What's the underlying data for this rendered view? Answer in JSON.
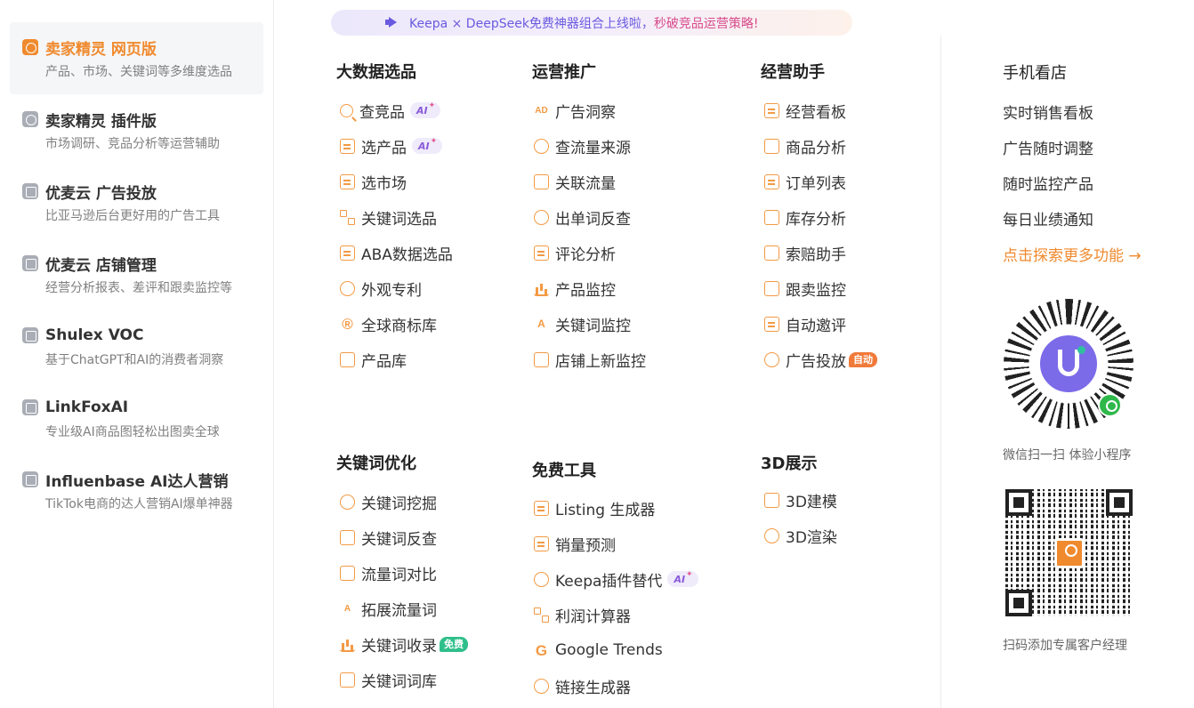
{
  "products": [
    {
      "name": "卖家精灵 网页版",
      "desc": "产品、市场、关键词等多维度选品",
      "icon": "globe-icon"
    },
    {
      "name": "卖家精灵 插件版",
      "desc": "市场调研、竞品分析等运营辅助",
      "icon": "puzzle-icon"
    },
    {
      "name": "优麦云 广告投放",
      "desc": "比亚马逊后台更好用的广告工具",
      "icon": "u-icon"
    },
    {
      "name": "优麦云 店铺管理",
      "desc": "经营分析报表、差评和跟卖监控等",
      "icon": "store-icon"
    },
    {
      "name": "Shulex VOC",
      "desc": "基于ChatGPT和AI的消费者洞察",
      "icon": "voc-icon"
    },
    {
      "name": "LinkFoxAI",
      "desc": "专业级AI商品图轻松出图卖全球",
      "icon": "linkfox-icon"
    },
    {
      "name": "Influenbase AI达人营销",
      "desc": "TikTok电商的达人营销AI爆单神器",
      "icon": "influencer-icon"
    }
  ],
  "banner": {
    "text": "Keepa × DeepSeek免费神器组合上线啦，",
    "highlight": "秒破竞品运营策略!"
  },
  "badges": {
    "ai": "AI",
    "free": "免费",
    "auto": "自动"
  },
  "sections": {
    "big_data": {
      "title": "大数据选品",
      "items": [
        "查竞品",
        "选产品",
        "选市场",
        "关键词选品",
        "ABA数据选品",
        "外观专利",
        "全球商标库",
        "产品库"
      ]
    },
    "ops": {
      "title": "运营推广",
      "items": [
        "广告洞察",
        "查流量来源",
        "关联流量",
        "出单词反查",
        "评论分析",
        "产品监控",
        "关键词监控",
        "店铺上新监控"
      ]
    },
    "assist": {
      "title": "经营助手",
      "items": [
        "经营看板",
        "商品分析",
        "订单列表",
        "库存分析",
        "索赔助手",
        "跟卖监控",
        "自动邀评",
        "广告投放"
      ]
    },
    "keyword": {
      "title": "关键词优化",
      "items": [
        "关键词挖掘",
        "关键词反查",
        "流量词对比",
        "拓展流量词",
        "关键词收录",
        "关键词词库"
      ]
    },
    "free_tools": {
      "title": "免费工具",
      "items": [
        "Listing 生成器",
        "销量预测",
        "Keepa插件替代",
        "利润计算器",
        "Google Trends",
        "链接生成器"
      ]
    },
    "three_d": {
      "title": "3D展示",
      "items": [
        "3D建模",
        "3D渲染"
      ]
    }
  },
  "mobile": {
    "title": "手机看店",
    "items": [
      "实时销售看板",
      "广告随时调整",
      "随时监控产品",
      "每日业绩通知"
    ],
    "explore": "点击探索更多功能 →",
    "qr1_caption": "微信扫一扫 体验小程序",
    "qr2_caption": "扫码添加专属客户经理",
    "qr2_logo": "卖家精灵"
  },
  "colors": {
    "accent": "#f08a2e",
    "icon": "#f39a44",
    "ai": "#8a5ad9",
    "free": "#2fbf8a",
    "auto": "#f07a3a"
  }
}
